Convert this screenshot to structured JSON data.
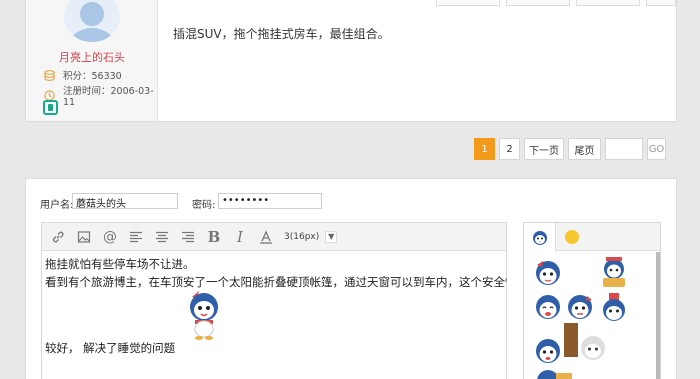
{
  "post": {
    "username": "月亮上的石头",
    "points_label": "积分：56330",
    "reg_label": "注册时间：2006-03-11",
    "text": "插混SUV，拖个拖挂式房车，最佳组合。"
  },
  "pagination": {
    "current": "1",
    "page2": "2",
    "next": "下一页",
    "last": "尾页",
    "jump_value": "",
    "go": "GO"
  },
  "reply": {
    "username_label": "用户名:",
    "username_value": "蘑菇头的头",
    "password_label": "密码:",
    "password_value": "••••••••",
    "font_size": "3(16px)",
    "caret": "▼",
    "lines": [
      "拖挂就怕有些停车场不让进。",
      "看到有个旅游博主，在车顶安了一个太阳能折叠硬顶帐篷，通过天窗可以到车内，这个安全性比"
    ],
    "line3": "较好， 解决了睡觉的问题"
  },
  "emoji": {
    "tabs": [
      "penguin-tab",
      "smiley-tab"
    ]
  },
  "colors": {
    "accent": "#f39a1b",
    "username": "#c8444e",
    "badge": "#17a98a"
  }
}
